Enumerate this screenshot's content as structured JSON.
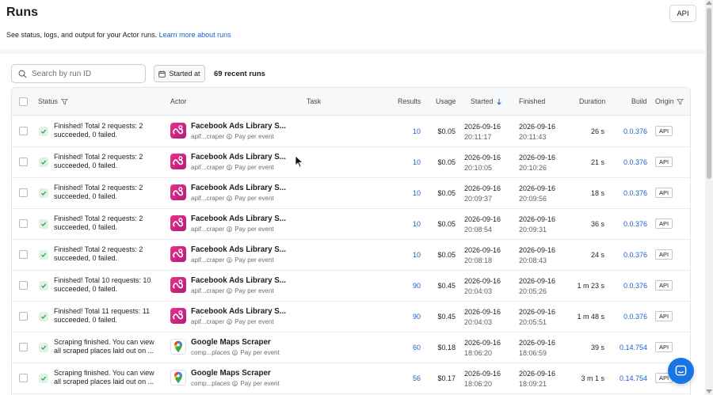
{
  "header": {
    "title": "Runs",
    "subtitle": "See status, logs, and output for your Actor runs.",
    "learn_more": "Learn more about runs",
    "api_label": "API"
  },
  "toolbar": {
    "search_placeholder": "Search by run ID",
    "started_at_label": "Started at",
    "recent_runs": "69 recent runs"
  },
  "columns": {
    "status": "Status",
    "actor": "Actor",
    "task": "Task",
    "results": "Results",
    "usage": "Usage",
    "started": "Started",
    "finished": "Finished",
    "duration": "Duration",
    "build": "Build",
    "origin": "Origin"
  },
  "rows": [
    {
      "status": "Finished! Total 2 requests: 2 succeeded, 0 failed.",
      "actor_name": "Facebook Ads Library S...",
      "actor_id": "apif...craper",
      "pricing": "Pay per event",
      "icon": "facebook-ads-icon",
      "results": "10",
      "usage": "$0.05",
      "started_date": "2026-09-16",
      "started_time": "20:11:17",
      "finished_date": "2026-09-16",
      "finished_time": "20:11:43",
      "duration": "26 s",
      "build": "0.0.376",
      "origin": "API"
    },
    {
      "status": "Finished! Total 2 requests: 2 succeeded, 0 failed.",
      "actor_name": "Facebook Ads Library S...",
      "actor_id": "apif...craper",
      "pricing": "Pay per event",
      "icon": "facebook-ads-icon",
      "results": "10",
      "usage": "$0.05",
      "started_date": "2026-09-16",
      "started_time": "20:10:05",
      "finished_date": "2026-09-16",
      "finished_time": "20:10:26",
      "duration": "21 s",
      "build": "0.0.376",
      "origin": "API"
    },
    {
      "status": "Finished! Total 2 requests: 2 succeeded, 0 failed.",
      "actor_name": "Facebook Ads Library S...",
      "actor_id": "apif...craper",
      "pricing": "Pay per event",
      "icon": "facebook-ads-icon",
      "results": "10",
      "usage": "$0.05",
      "started_date": "2026-09-16",
      "started_time": "20:09:37",
      "finished_date": "2026-09-16",
      "finished_time": "20:09:56",
      "duration": "18 s",
      "build": "0.0.376",
      "origin": "API"
    },
    {
      "status": "Finished! Total 2 requests: 2 succeeded, 0 failed.",
      "actor_name": "Facebook Ads Library S...",
      "actor_id": "apif...craper",
      "pricing": "Pay per event",
      "icon": "facebook-ads-icon",
      "results": "10",
      "usage": "$0.05",
      "started_date": "2026-09-16",
      "started_time": "20:08:54",
      "finished_date": "2026-09-16",
      "finished_time": "20:09:31",
      "duration": "36 s",
      "build": "0.0.376",
      "origin": "API"
    },
    {
      "status": "Finished! Total 2 requests: 2 succeeded, 0 failed.",
      "actor_name": "Facebook Ads Library S...",
      "actor_id": "apif...craper",
      "pricing": "Pay per event",
      "icon": "facebook-ads-icon",
      "results": "10",
      "usage": "$0.05",
      "started_date": "2026-09-16",
      "started_time": "20:08:18",
      "finished_date": "2026-09-16",
      "finished_time": "20:08:43",
      "duration": "24 s",
      "build": "0.0.376",
      "origin": "API"
    },
    {
      "status": "Finished! Total 10 requests: 10 succeeded, 0 failed.",
      "actor_name": "Facebook Ads Library S...",
      "actor_id": "apif...craper",
      "pricing": "Pay per event",
      "icon": "facebook-ads-icon",
      "results": "90",
      "usage": "$0.45",
      "started_date": "2026-09-16",
      "started_time": "20:04:03",
      "finished_date": "2026-09-16",
      "finished_time": "20:05:26",
      "duration": "1 m 23 s",
      "build": "0.0.376",
      "origin": "API"
    },
    {
      "status": "Finished! Total 11 requests: 11 succeeded, 0 failed.",
      "actor_name": "Facebook Ads Library S...",
      "actor_id": "apif...craper",
      "pricing": "Pay per event",
      "icon": "facebook-ads-icon",
      "results": "90",
      "usage": "$0.45",
      "started_date": "2026-09-16",
      "started_time": "20:04:03",
      "finished_date": "2026-09-16",
      "finished_time": "20:05:51",
      "duration": "1 m 48 s",
      "build": "0.0.376",
      "origin": "API"
    },
    {
      "status": "Scraping finished. You can view all scraped places laid out on ...",
      "actor_name": "Google Maps Scraper",
      "actor_id": "comp...places",
      "pricing": "Pay per event",
      "icon": "google-maps-icon",
      "results": "60",
      "usage": "$0.18",
      "started_date": "2026-09-16",
      "started_time": "18:06:20",
      "finished_date": "2026-09-16",
      "finished_time": "18:06:59",
      "duration": "39 s",
      "build": "0.14.754",
      "origin": "API"
    },
    {
      "status": "Scraping finished. You can view all scraped places laid out on ...",
      "actor_name": "Google Maps Scraper",
      "actor_id": "comp...places",
      "pricing": "Pay per event",
      "icon": "google-maps-icon",
      "results": "56",
      "usage": "$0.17",
      "started_date": "2026-09-16",
      "started_time": "18:06:20",
      "finished_date": "2026-09-16",
      "finished_time": "18:09:21",
      "duration": "3 m 1 s",
      "build": "0.14.754",
      "origin": "API"
    }
  ],
  "colors": {
    "link": "#1a5fc9",
    "success": "#2e9e4f",
    "facebook_icon": "#d6287f",
    "chat_button": "#1b74e4"
  }
}
